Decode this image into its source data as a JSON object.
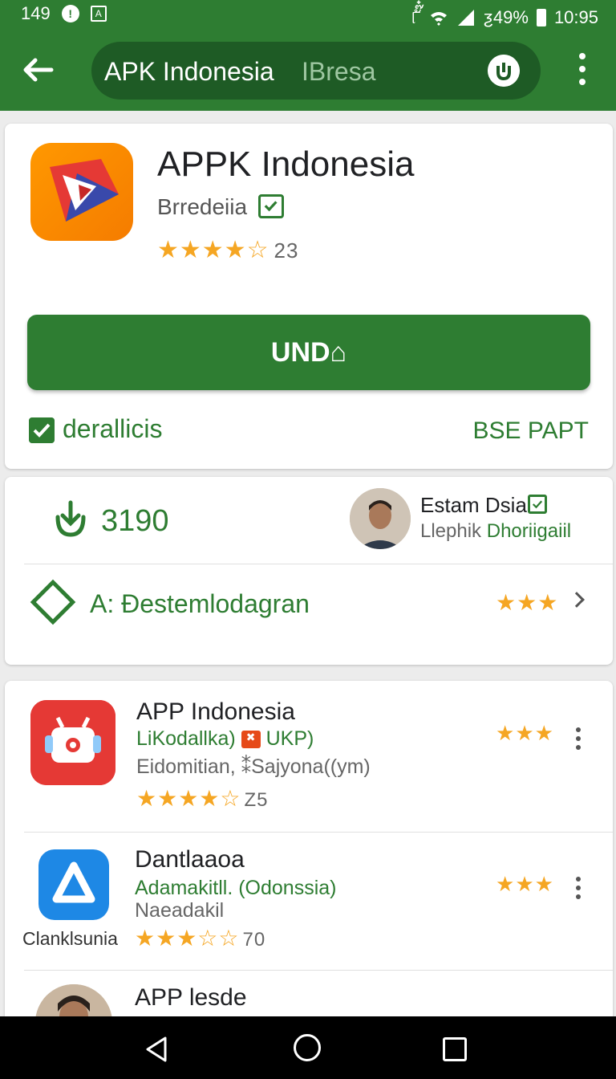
{
  "status": {
    "time_left": "149",
    "carrier": "୮ั๊๋",
    "battery": "ƺ49%",
    "clock": "10:95"
  },
  "search": {
    "query": "APK Indonesia",
    "placeholder": "IBresa"
  },
  "app": {
    "title": "APPK Indonesia",
    "developer": "Brredeiia",
    "rating_stars": "★★★★☆",
    "rating_count": "23",
    "install_label": "UND⌂",
    "checkbox_label": "derallicis",
    "link_label": "BSE PAPT"
  },
  "stats": {
    "downloads": "3190",
    "publisher_name": "Estam Dsia",
    "publisher_sub_a": "Llephik",
    "publisher_sub_b": "Dhoriigaiil",
    "category": "A: Ɖestemlodagran",
    "category_rating": 2.5
  },
  "list": [
    {
      "title": "APP Indonesia",
      "subtitle": "LiKodallka)",
      "badge_text": "UKP)",
      "desc": "Eidomitian, ⁑Sajyona((ym)",
      "stars": "★★★★☆",
      "count": "Z5",
      "right_rating": 2.5
    },
    {
      "title": "Dantlaaoa",
      "subtitle": "Adamakitll. (Odonssia)",
      "desc": "Naeadakil",
      "side_label": "Clanklsunia",
      "stars": "★★★☆☆",
      "count": "70",
      "right_rating": 2.5
    },
    {
      "title": "APP lesde"
    }
  ],
  "colors": {
    "brand_green": "#2e7d32",
    "star_gold": "#f5a623"
  }
}
